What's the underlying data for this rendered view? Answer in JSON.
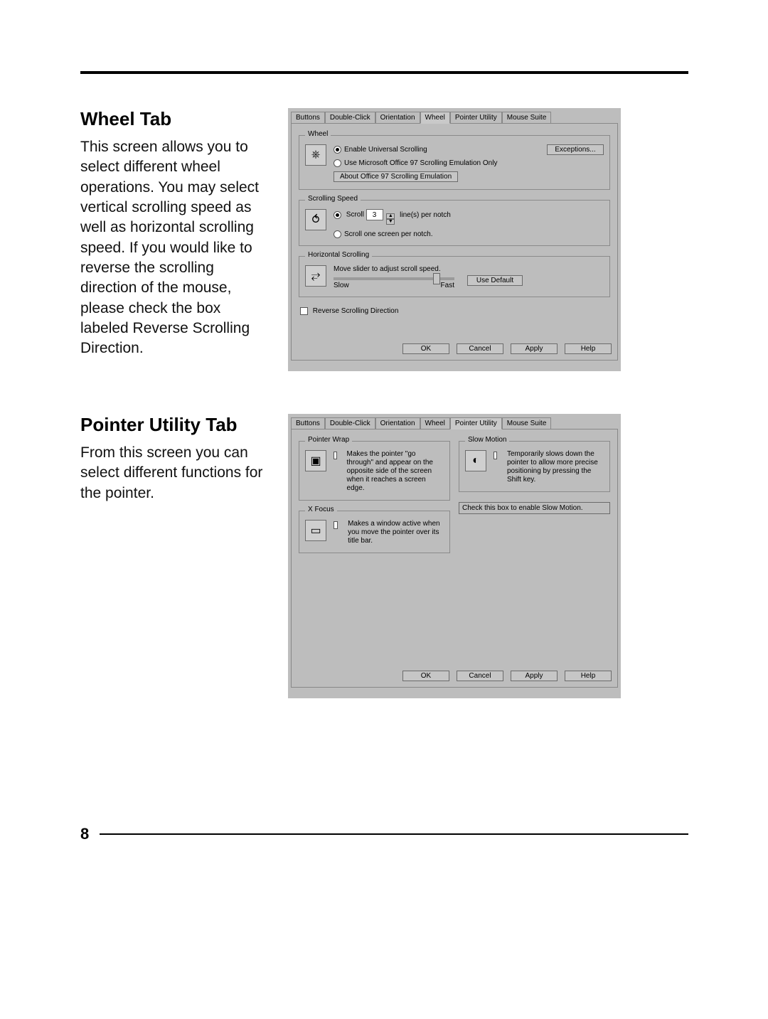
{
  "section1": {
    "heading": "Wheel Tab",
    "body": "This screen allows you to select different wheel operations.  You may select vertical scrolling speed as well as horizontal scrolling speed.  If you would like to reverse the scrolling direction of the mouse, please check the box labeled Reverse Scrolling Direction."
  },
  "section2": {
    "heading": "Pointer Utility Tab",
    "body": "From this screen you can select different functions for the pointer."
  },
  "tabs": {
    "buttons": "Buttons",
    "double_click": "Double-Click",
    "orientation": "Orientation",
    "wheel": "Wheel",
    "pointer_utility": "Pointer Utility",
    "mouse_suite": "Mouse Suite"
  },
  "wheel_dialog": {
    "grp_wheel": "Wheel",
    "enable_universal": "Enable Universal Scrolling",
    "use_office": "Use Microsoft Office 97 Scrolling Emulation Only",
    "btn_exceptions": "Exceptions...",
    "btn_about": "About Office 97 Scrolling Emulation",
    "grp_speed": "Scrolling Speed",
    "scroll_label_pre": "Scroll",
    "scroll_value": "3",
    "scroll_label_post": "line(s) per notch",
    "scroll_screen": "Scroll one screen per notch.",
    "grp_horiz": "Horizontal Scrolling",
    "horiz_text": "Move slider to adjust scroll speed.",
    "slow": "Slow",
    "fast": "Fast",
    "btn_default": "Use Default",
    "reverse": "Reverse Scrolling Direction"
  },
  "pointer_dialog": {
    "grp_wrap": "Pointer Wrap",
    "wrap_text": "Makes the pointer \"go through\" and appear on the opposite side of the screen when it reaches a screen edge.",
    "grp_slow": "Slow Motion",
    "slow_text": "Temporarily slows down the pointer to allow more precise positioning by pressing the Shift key.",
    "slow_hint": "Check this box to enable Slow Motion.",
    "grp_focus": "X Focus",
    "focus_text": "Makes a window active when you move the pointer over its title bar."
  },
  "buttons": {
    "ok": "OK",
    "cancel": "Cancel",
    "apply": "Apply",
    "help": "Help"
  },
  "page_number": "8"
}
